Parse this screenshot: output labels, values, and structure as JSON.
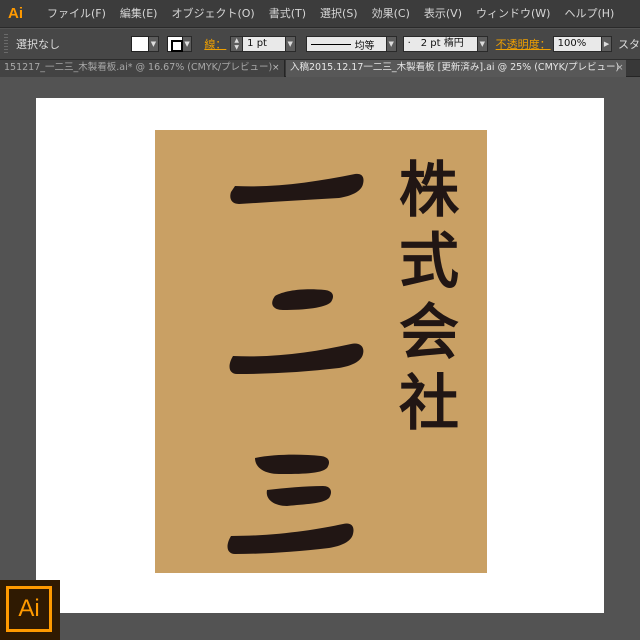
{
  "app": {
    "logo_text": "Ai"
  },
  "menu": {
    "items": [
      "ファイル(F)",
      "編集(E)",
      "オブジェクト(O)",
      "書式(T)",
      "選択(S)",
      "効果(C)",
      "表示(V)",
      "ウィンドウ(W)",
      "ヘルプ(H)"
    ]
  },
  "control": {
    "selection_status": "選択なし",
    "stroke_label": "線：",
    "stroke_weight": "1 pt",
    "stroke_profile": "均等",
    "brush_value": "·　2 pt 楕円",
    "opacity_label": "不透明度：",
    "opacity_value": "100%",
    "overflow_text": "スタ"
  },
  "tabs": [
    {
      "label": "151217_一二三_木製看板.ai* @ 16.67% (CMYK/プレビュー)",
      "close": "×",
      "active": false
    },
    {
      "label": "入稿2015.12.17一二三_木製看板 [更新済み].ai @ 25% (CMYK/プレビュー)",
      "close": "×",
      "active": true
    }
  ],
  "artwork": {
    "company_text": [
      "株",
      "式",
      "会",
      "社"
    ],
    "name_characters": [
      "一",
      "二",
      "三"
    ]
  },
  "colors": {
    "board": "#c9a064",
    "ink": "#211614",
    "accent": "#ff9a00"
  },
  "badge": {
    "text": "Ai"
  }
}
